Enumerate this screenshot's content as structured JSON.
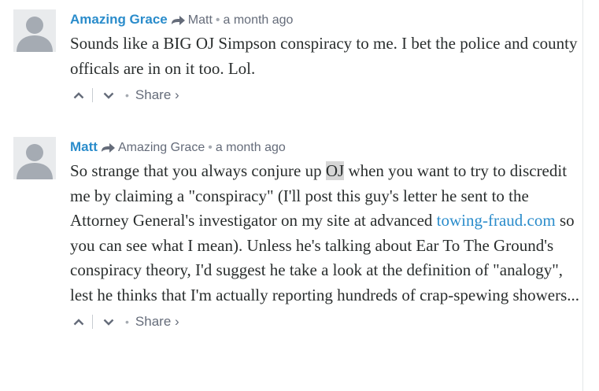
{
  "comments": [
    {
      "author": "Amazing Grace",
      "reply_to": "Matt",
      "time": "a month ago",
      "text": "Sounds like a BIG OJ Simpson conspiracy to me. I bet the police and county officals are in on it too. Lol.",
      "share_label": "Share ›"
    },
    {
      "author": "Matt",
      "reply_to": "Amazing Grace",
      "time": "a month ago",
      "text_before": "So strange that you always conjure up ",
      "text_highlight": "OJ",
      "text_middle": " when you want to try to discredit me by claiming a \"conspiracy\" (I'll post this guy's letter he sent to the Attorney General's investigator on my site at advanced ",
      "link_text": "towing-fraud.com",
      "text_after": " so you can see what I mean). Unless he's talking about Ear To The Ground's conspiracy theory, I'd suggest he take a look at the definition of \"analogy\", lest he thinks that I'm actually reporting hundreds of crap-spewing showers...",
      "share_label": "Share ›"
    }
  ],
  "colors": {
    "author": "#2a8ccb",
    "meta": "#656c7a",
    "text": "#2a2e2e",
    "link": "#2a8ccb",
    "avatar_bg": "#e9ebed",
    "avatar_fg": "#a5abb3"
  },
  "icons": {
    "reply_arrow": "reply-arrow-icon",
    "upvote": "chevron-up-icon",
    "downvote": "chevron-down-icon",
    "avatar": "user-silhouette-icon"
  }
}
